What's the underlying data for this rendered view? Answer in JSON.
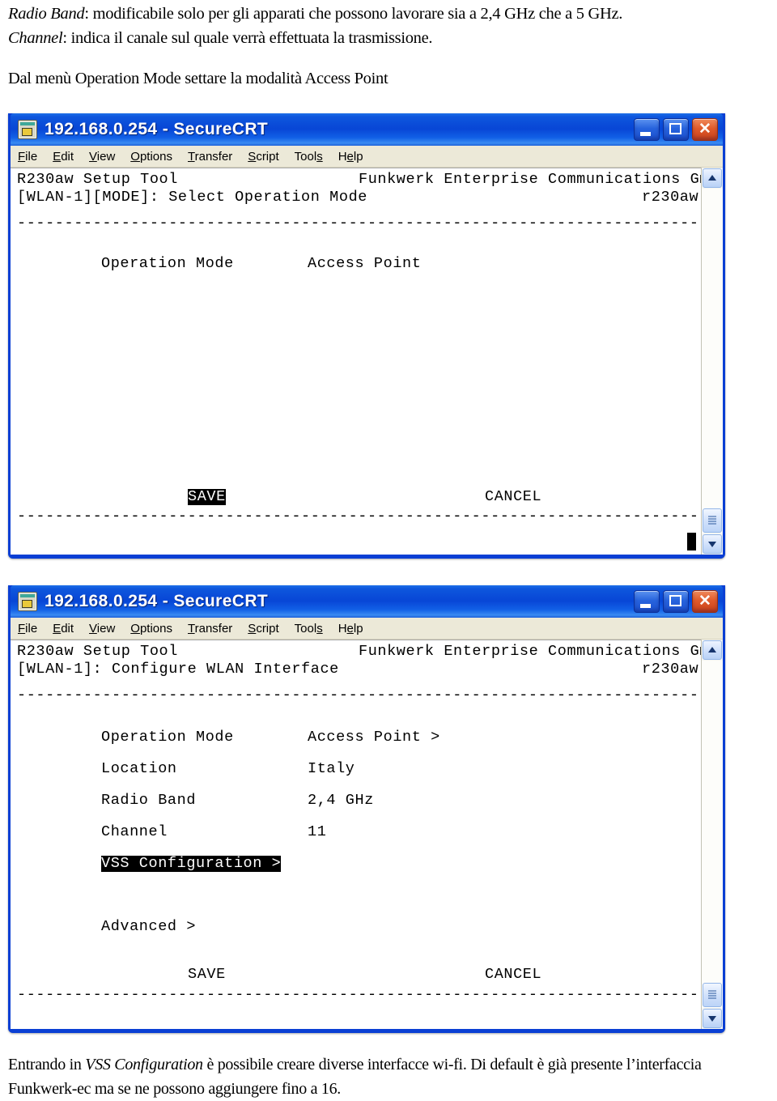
{
  "document": {
    "intro_line_1_italic": "Radio Band",
    "intro_line_1_rest": ": modificabile solo per gli apparati che possono lavorare sia a 2,4 GHz che a 5 GHz.",
    "intro_line_2_italic": "Channel",
    "intro_line_2_rest": ": indica il canale sul quale verrà effettuata la trasmissione.",
    "lead_text": "Dal menù Operation Mode settare la modalità Access Point",
    "outro_part_1": "Entrando in ",
    "outro_italic": "VSS Configuration",
    "outro_part_2": " è possibile creare diverse interfacce wi-fi. Di default è già presente l’interfaccia Funkwerk-ec ma se ne possono aggiungere fino a 16."
  },
  "window": {
    "title": "192.168.0.254 - SecureCRT",
    "icon": "securecrt-session-icon",
    "buttons": {
      "minimize": "minimize-button",
      "maximize": "maximize-button",
      "close": "close-button",
      "close_glyph": "✕"
    },
    "menu": [
      {
        "pre": "",
        "accel": "F",
        "post": "ile"
      },
      {
        "pre": "",
        "accel": "E",
        "post": "dit"
      },
      {
        "pre": "",
        "accel": "V",
        "post": "iew"
      },
      {
        "pre": "",
        "accel": "O",
        "post": "ptions"
      },
      {
        "pre": "",
        "accel": "T",
        "post": "ransfer"
      },
      {
        "pre": "",
        "accel": "S",
        "post": "cript"
      },
      {
        "pre": "Tool",
        "accel": "s",
        "post": ""
      },
      {
        "pre": "H",
        "accel": "e",
        "post": "lp"
      }
    ]
  },
  "terminal_1": {
    "header_left": "R230aw Setup Tool",
    "header_right": "Funkwerk Enterprise Communications GmbH",
    "subheader_left": "[WLAN-1][MODE]: Select Operation Mode",
    "subheader_right": "r230aw",
    "divider_top": "--------------------------------------------------------------------------------",
    "field_label": "Operation Mode",
    "field_value": "Access Point",
    "save_label": "SAVE",
    "save_highlighted": true,
    "cancel_label": "CANCEL",
    "divider_bottom": "--------------------------------------------------------------------------------",
    "cursor": "block-cursor"
  },
  "terminal_2": {
    "header_left": "R230aw Setup Tool",
    "header_right": "Funkwerk Enterprise Communications GmbH",
    "subheader_left": "[WLAN-1]: Configure WLAN Interface",
    "subheader_right": "r230aw",
    "divider_top": "--------------------------------------------------------------------------------",
    "rows": [
      {
        "label": "Operation Mode",
        "value": "Access Point >"
      },
      {
        "label": "Location",
        "value": "Italy"
      },
      {
        "label": "Radio Band",
        "value": "2,4 GHz"
      },
      {
        "label": "Channel",
        "value": "11"
      }
    ],
    "submenu_highlighted": "VSS Configuration >",
    "submenu_advanced": "Advanced >",
    "save_label": "SAVE",
    "save_highlighted": false,
    "cancel_label": "CANCEL",
    "divider_bottom": "--------------------------------------------------------------------------------"
  },
  "colors": {
    "titlebar_blue": "#0846d6",
    "menubar": "#ece9d8",
    "terminal_bg": "#ffffff",
    "terminal_fg": "#000000",
    "close_red": "#e05a2b"
  }
}
